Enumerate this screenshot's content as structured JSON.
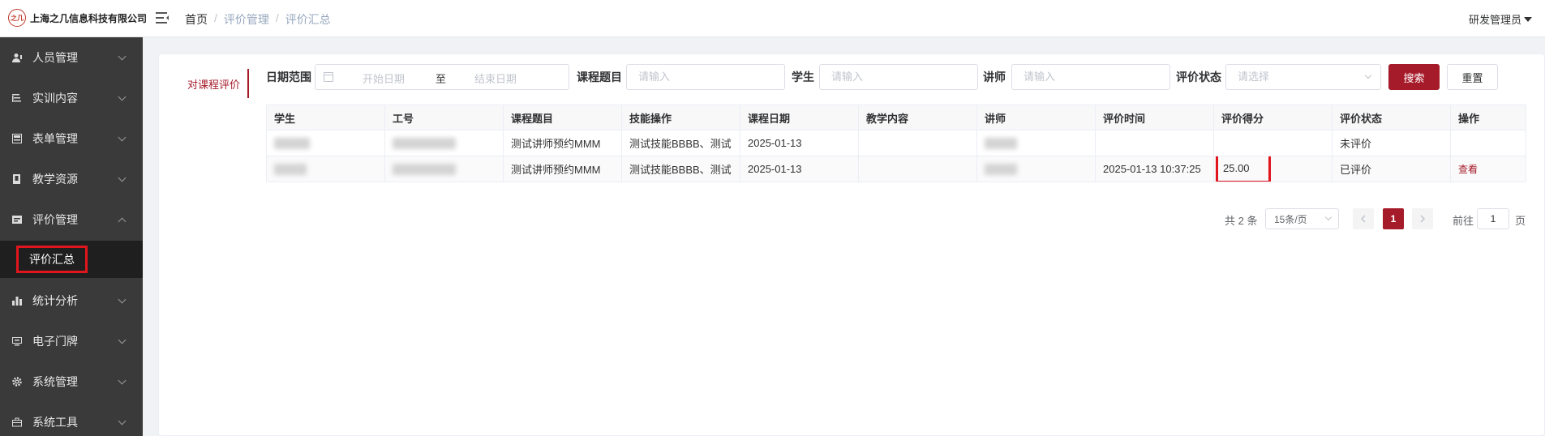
{
  "brand": {
    "badge": "之几",
    "name": "上海之几信息科技有限公司"
  },
  "breadcrumb": [
    "首页",
    "评价管理",
    "评价汇总"
  ],
  "user": {
    "name": "研发管理员"
  },
  "sidebar": {
    "items": [
      {
        "label": "人员管理",
        "icon": "user-icon"
      },
      {
        "label": "实训内容",
        "icon": "list-icon"
      },
      {
        "label": "表单管理",
        "icon": "form-icon"
      },
      {
        "label": "教学资源",
        "icon": "book-icon"
      },
      {
        "label": "评价管理",
        "icon": "evaluate-icon",
        "expanded": true
      },
      {
        "label": "统计分析",
        "icon": "bar-chart-icon"
      },
      {
        "label": "电子门牌",
        "icon": "monitor-icon"
      },
      {
        "label": "系统管理",
        "icon": "gear-icon"
      },
      {
        "label": "系统工具",
        "icon": "toolbox-icon"
      }
    ],
    "active_sub": "评价汇总"
  },
  "tabs": {
    "active": "对课程评价"
  },
  "filters": {
    "date_label": "日期范围",
    "date_start_placeholder": "开始日期",
    "date_sep": "至",
    "date_end_placeholder": "结束日期",
    "course_label": "课程题目",
    "course_placeholder": "请输入",
    "student_label": "学生",
    "student_placeholder": "请输入",
    "teacher_label": "讲师",
    "teacher_placeholder": "请输入",
    "status_label": "评价状态",
    "status_placeholder": "请选择",
    "search_label": "搜索",
    "reset_label": "重置"
  },
  "table": {
    "columns": [
      "学生",
      "工号",
      "课程题目",
      "技能操作",
      "课程日期",
      "教学内容",
      "讲师",
      "评价时间",
      "评价得分",
      "评价状态",
      "操作"
    ],
    "rows": [
      {
        "course": "测试讲师预约MMM",
        "skill": "测试技能BBBB、测试",
        "date": "2025-01-13",
        "content": "",
        "eval_time": "",
        "score": "",
        "status": "未评价",
        "action": ""
      },
      {
        "course": "测试讲师预约MMM",
        "skill": "测试技能BBBB、测试",
        "date": "2025-01-13",
        "content": "",
        "eval_time": "2025-01-13 10:37:25",
        "score": "25.00",
        "status": "已评价",
        "action": "查看"
      }
    ]
  },
  "pagination": {
    "total": "共 2 条",
    "page_size": "15条/页",
    "current_page": "1",
    "goto_label": "前往",
    "goto_value": "1",
    "page_unit": "页"
  },
  "colors": {
    "accent": "#a61b29",
    "sidebar_bg": "#3a3a3a",
    "highlight": "#e0151d"
  }
}
